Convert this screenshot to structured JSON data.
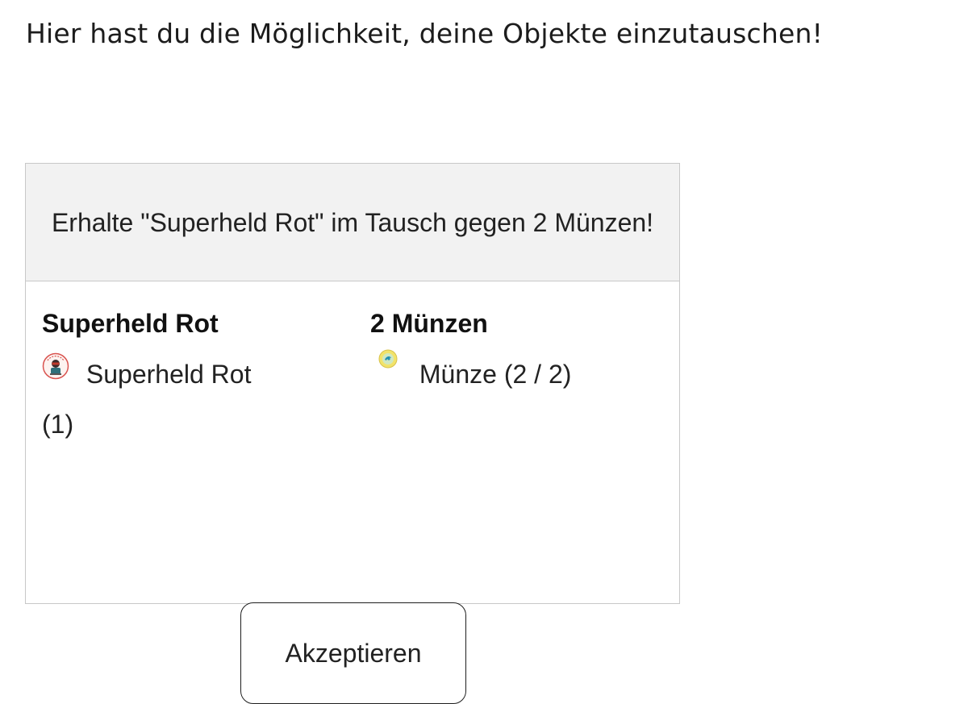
{
  "intro_text": "Hier hast du die Möglichkeit, deine Objekte einzutauschen!",
  "offer": {
    "header_text": "Erhalte \"Superheld Rot\" im Tausch gegen 2 Münzen!",
    "receive": {
      "title": "Superheld Rot",
      "item_name": "Superheld Rot",
      "item_count": "(1)",
      "icon": "superhero-red-icon"
    },
    "give": {
      "title": "2 Münzen",
      "item_label": "Münze (2 / 2)",
      "icon": "coin-icon"
    },
    "accept_label": "Akzeptieren"
  }
}
